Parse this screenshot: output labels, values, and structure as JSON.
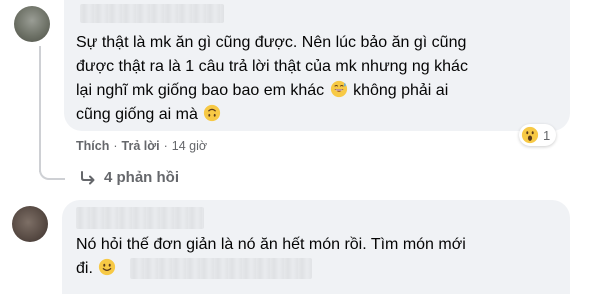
{
  "comment1": {
    "lines": [
      "Sự thật là mk ăn gì cũng được. Nên lúc bảo ăn gì cũng",
      "được thật ra là 1 câu trả lời thật của mk nhưng ng khác",
      "lại nghĩ mk giống bao bao em khác",
      "không phải ai",
      "cũng giống ai mà"
    ],
    "emojis": [
      "grinning-sweat-emoji",
      "upside-down-face-emoji"
    ],
    "actions": {
      "like_label": "Thích",
      "reply_label": "Trả lời",
      "time": "14 giờ"
    },
    "reaction": {
      "icon": "wow-reaction-icon",
      "count": "1"
    },
    "replies_label": "4 phản hồi"
  },
  "comment2": {
    "lines": [
      "Nó hỏi thế đơn giản là nó ăn hết món rồi. Tìm món mới",
      "đi."
    ],
    "emojis": [
      "smile-emoji"
    ]
  },
  "colors": {
    "bubble_bg": "#f0f2f5",
    "meta_text": "#65676b",
    "body_text": "#050505",
    "emoji_yellow": "#f7c945",
    "connector": "#ced0d4"
  }
}
